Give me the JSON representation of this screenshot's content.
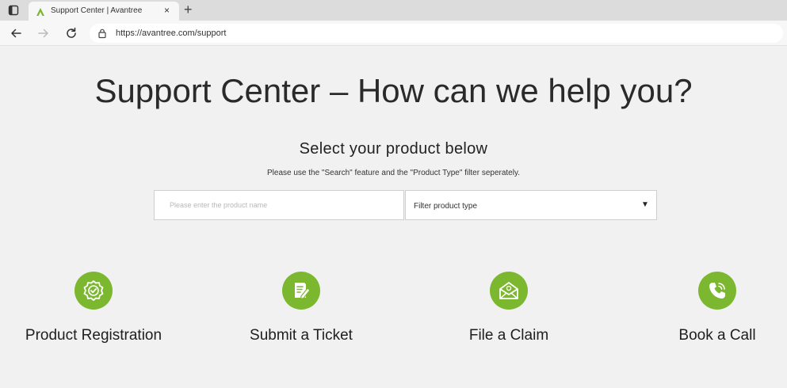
{
  "browser": {
    "tab": {
      "title": "Support Center | Avantree",
      "close_glyph": "×",
      "favicon": "avantree-logo-icon"
    },
    "new_tab_glyph": "+",
    "address": {
      "url": "https://avantree.com/support"
    },
    "icons": [
      "window-menu-icon",
      "back-arrow-icon",
      "forward-arrow-icon",
      "reload-icon",
      "lock-icon"
    ]
  },
  "page": {
    "headline": "Support Center – How can we help you?",
    "subhead": "Select your product below",
    "note": "Please use the \"Search\" feature and the \"Product Type\" filter seperately.",
    "search": {
      "placeholder": "Please enter the product name",
      "value": ""
    },
    "filter": {
      "selected": "Filter product type",
      "arrow_glyph": "▼"
    },
    "cards": [
      {
        "label": "Product Registration",
        "icon": "badge-check-icon"
      },
      {
        "label": "Submit a Ticket",
        "icon": "ticket-pencil-icon"
      },
      {
        "label": "File a Claim",
        "icon": "envelope-at-icon"
      },
      {
        "label": "Book a Call",
        "icon": "phone-call-icon"
      }
    ]
  },
  "colors": {
    "accent_green": "#7cb82f",
    "page_background": "#f1f1f1",
    "tabstrip_background": "#dcdcdc"
  }
}
